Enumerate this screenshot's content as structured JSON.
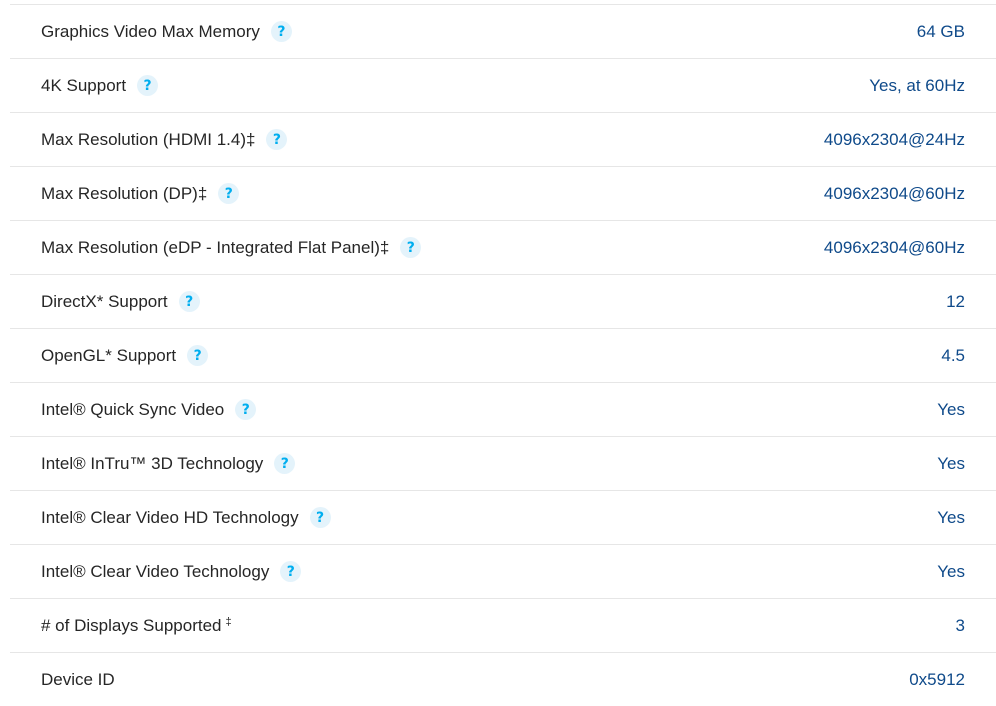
{
  "help_glyph": "?",
  "rows": [
    {
      "label": "Graphics Video Max Memory",
      "value": "64 GB",
      "help": true
    },
    {
      "label": "4K Support",
      "value": "Yes, at 60Hz",
      "help": true
    },
    {
      "label": "Max Resolution (HDMI 1.4)‡",
      "value": "4096x2304@24Hz",
      "help": true
    },
    {
      "label": "Max Resolution (DP)‡",
      "value": "4096x2304@60Hz",
      "help": true
    },
    {
      "label": "Max Resolution (eDP - Integrated Flat Panel)‡",
      "value": "4096x2304@60Hz",
      "help": true
    },
    {
      "label": "DirectX* Support",
      "value": "12",
      "help": true
    },
    {
      "label": "OpenGL* Support",
      "value": "4.5",
      "help": true
    },
    {
      "label": "Intel® Quick Sync Video",
      "value": "Yes",
      "help": true
    },
    {
      "label": "Intel® InTru™ 3D Technology",
      "value": "Yes",
      "help": true
    },
    {
      "label": "Intel® Clear Video HD Technology",
      "value": "Yes",
      "help": true
    },
    {
      "label": "Intel® Clear Video Technology",
      "value": "Yes",
      "help": true
    },
    {
      "label": "# of Displays Supported",
      "sup": "‡",
      "value": "3",
      "help": false
    },
    {
      "label": "Device ID",
      "value": "0x5912",
      "help": false
    }
  ],
  "colors": {
    "value_text": "#0f4a8a",
    "help_icon": "#00aeef",
    "help_icon_bg": "#e4f3fb",
    "divider": "#e6e6e6"
  }
}
